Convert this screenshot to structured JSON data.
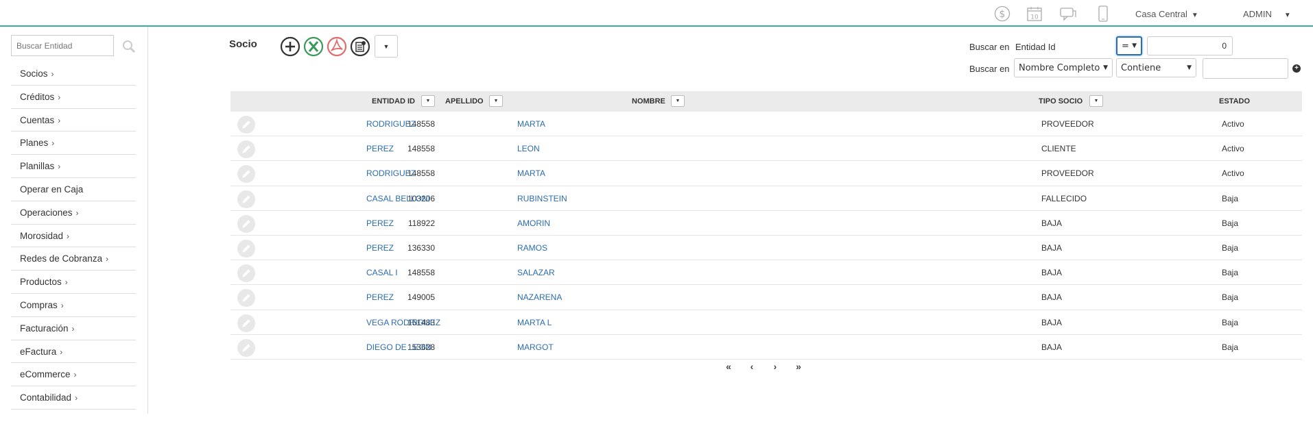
{
  "topbar": {
    "icons": [
      "dollar-icon",
      "calendar-icon",
      "chat-icon",
      "mobile-icon"
    ],
    "calendar_day": "10",
    "branch": "Casa Central",
    "user": "ADMIN"
  },
  "sidebar": {
    "search_placeholder": "Buscar Entidad",
    "items": [
      {
        "label": "Socios",
        "has_arrow": true
      },
      {
        "label": "Créditos",
        "has_arrow": true
      },
      {
        "label": "Cuentas",
        "has_arrow": true
      },
      {
        "label": "Planes",
        "has_arrow": true
      },
      {
        "label": "Planillas",
        "has_arrow": true
      },
      {
        "label": "Operar en Caja",
        "has_arrow": false
      },
      {
        "label": "Operaciones",
        "has_arrow": true
      },
      {
        "label": "Morosidad",
        "has_arrow": true
      },
      {
        "label": "Redes de Cobranza",
        "has_arrow": true
      },
      {
        "label": "Productos",
        "has_arrow": true
      },
      {
        "label": "Compras",
        "has_arrow": true
      },
      {
        "label": "Facturación",
        "has_arrow": true
      },
      {
        "label": "eFactura",
        "has_arrow": true
      },
      {
        "label": "eCommerce",
        "has_arrow": true
      },
      {
        "label": "Contabilidad",
        "has_arrow": true
      }
    ],
    "arrow": "›"
  },
  "main": {
    "title": "Socio",
    "actions": [
      "add-icon",
      "excel-icon",
      "pdf-icon",
      "report-icon"
    ],
    "filters": {
      "row1": {
        "label": "Buscar en",
        "field": "Entidad Id",
        "operator": "=",
        "value": "0"
      },
      "row2": {
        "label": "Buscar en",
        "field": "Nombre Completo",
        "operator": "Contiene",
        "value": ""
      }
    }
  },
  "table": {
    "headers": {
      "entidad_id": "ENTIDAD ID",
      "apellido": "APELLIDO",
      "nombre": "NOMBRE",
      "tipo_socio": "TIPO SOCIO",
      "estado": "ESTADO"
    },
    "rows": [
      {
        "id": "148558",
        "apellido": "RODRIGUEZ",
        "nombre": "MARTA",
        "tipo": "PROVEEDOR",
        "estado": "Activo"
      },
      {
        "id": "148558",
        "apellido": "PEREZ",
        "nombre": "LEON",
        "tipo": "CLIENTE",
        "estado": "Activo"
      },
      {
        "id": "148558",
        "apellido": "RODRIGUEZ",
        "nombre": "MARTA",
        "tipo": "PROVEEDOR",
        "estado": "Activo"
      },
      {
        "id": "103206",
        "apellido": "CASAL BELLONI",
        "nombre": "RUBINSTEIN",
        "tipo": "FALLECIDO",
        "estado": "Baja"
      },
      {
        "id": "118922",
        "apellido": "PEREZ",
        "nombre": "AMORIN",
        "tipo": "BAJA",
        "estado": "Baja"
      },
      {
        "id": "136330",
        "apellido": "PEREZ",
        "nombre": "RAMOS",
        "tipo": "BAJA",
        "estado": "Baja"
      },
      {
        "id": "148558",
        "apellido": "CASAL I",
        "nombre": "SALAZAR",
        "tipo": "BAJA",
        "estado": "Baja"
      },
      {
        "id": "149005",
        "apellido": "PEREZ",
        "nombre": "NAZARENA",
        "tipo": "BAJA",
        "estado": "Baja"
      },
      {
        "id": "151483",
        "apellido": "VEGA RODRIGUEZ",
        "nombre": "MARTA L",
        "tipo": "BAJA",
        "estado": "Baja"
      },
      {
        "id": "153628",
        "apellido": "DIEGO DE LEON",
        "nombre": "MARGOT",
        "tipo": "BAJA",
        "estado": "Baja"
      }
    ]
  },
  "pager": {
    "first": "first-page-icon",
    "prev": "prev-page-icon",
    "next": "next-page-icon",
    "last": "last-page-icon"
  },
  "colors": {
    "accent": "#3aaaa4",
    "link": "#2b6cb0",
    "excel": "#3a9a5b",
    "pdf": "#e06c6c"
  }
}
